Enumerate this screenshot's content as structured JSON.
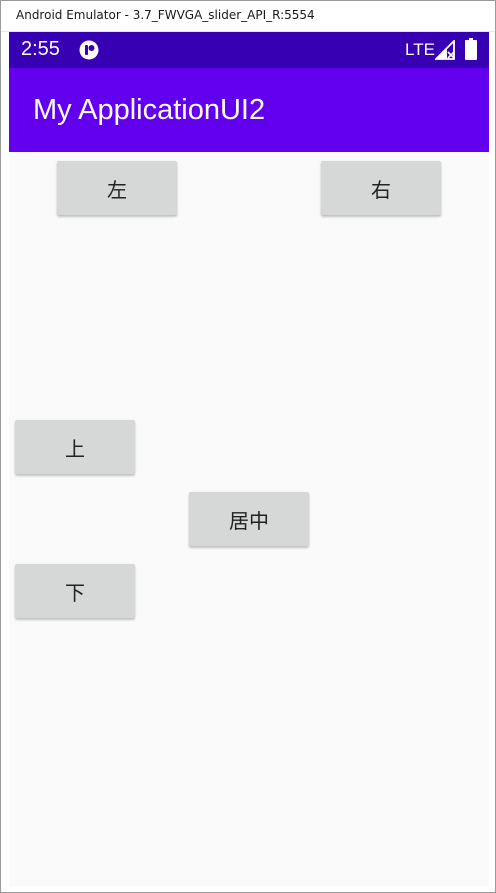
{
  "window": {
    "title": "Android Emulator - 3.7_FWVGA_slider_API_R:5554"
  },
  "statusbar": {
    "time": "2:55",
    "network": "LTE",
    "icons": [
      "notification-icon",
      "signal-icon",
      "battery-icon"
    ]
  },
  "appbar": {
    "title": "My ApplicationUI2"
  },
  "buttons": {
    "left": "左",
    "right": "右",
    "top": "上",
    "center": "居中",
    "bottom": "下"
  },
  "colors": {
    "statusbar": "#3700b3",
    "appbar": "#6200ee",
    "button": "#d6d7d7",
    "background": "#fafafa"
  }
}
